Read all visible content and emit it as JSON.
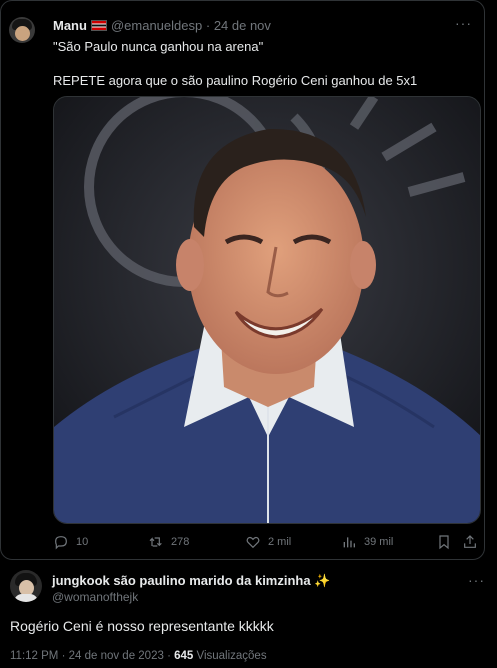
{
  "quoted_tweet": {
    "author_name": "Manu",
    "handle": "@emanueldesp",
    "separator": "·",
    "date": "24 de nov",
    "line1": "\"São Paulo nunca ganhou na arena\"",
    "line2": "REPETE agora que o são paulino Rogério Ceni ganhou de 5x1",
    "more_icon": "more-horizontal-icon",
    "actions": {
      "replies": "10",
      "retweets": "278",
      "likes": "2 mil",
      "views": "39 mil"
    }
  },
  "reply_tweet": {
    "author_name": "jungkook são paulino marido da kimzinha ✨",
    "handle": "@womanofthejk",
    "text": "Rogério Ceni é nosso representante kkkkk",
    "time": "11:12 PM · 24 de nov de 2023 · ",
    "views_count": "645",
    "views_label": " Visualizações"
  },
  "colors": {
    "background": "#000000",
    "text": "#e7e9ea",
    "muted": "#71767b",
    "border": "#2f3336",
    "sweater": "#2f3f73"
  }
}
